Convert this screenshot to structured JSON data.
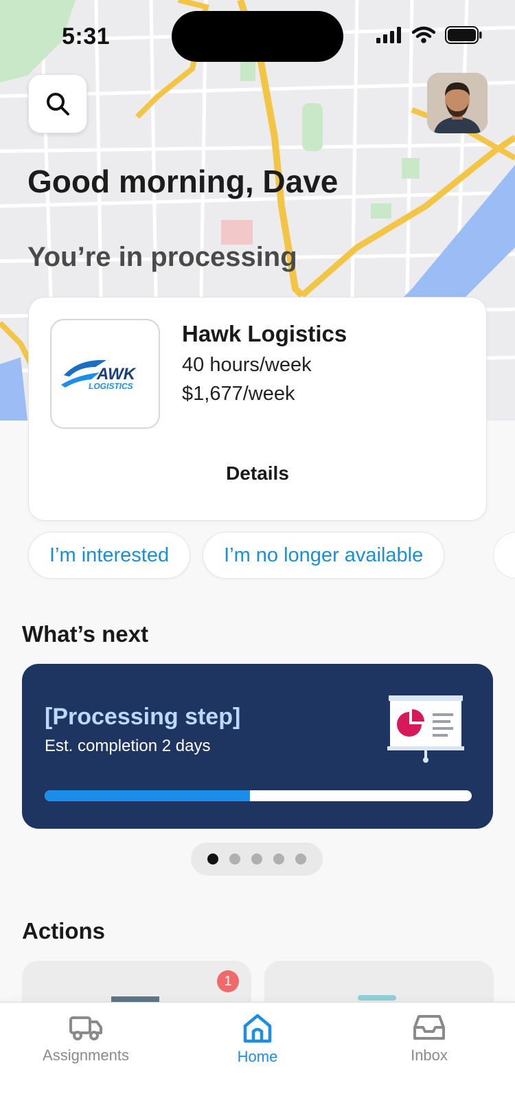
{
  "status_bar": {
    "time": "5:31"
  },
  "header": {
    "greeting": "Good morning, Dave",
    "subtitle": "You’re in processing"
  },
  "job_card": {
    "logo_text": "HAWK LOGISTICS",
    "company": "Hawk Logistics",
    "hours": "40 hours/week",
    "pay": "$1,677/week",
    "details_label": "Details"
  },
  "chips": {
    "interested": "I’m interested",
    "unavailable": "I’m no longer available"
  },
  "whats_next": {
    "title": "What’s next",
    "step_title": "[Processing step]",
    "step_sub": "Est. completion 2 days",
    "progress": 0.48,
    "pager_total": 5,
    "pager_active": 1
  },
  "actions": {
    "title": "Actions",
    "badge_count": "1"
  },
  "tabbar": {
    "tabs": [
      {
        "label": "Assignments",
        "icon": "truck-icon",
        "active": false
      },
      {
        "label": "Home",
        "icon": "home-icon",
        "active": true
      },
      {
        "label": "Inbox",
        "icon": "inbox-icon",
        "active": false
      }
    ]
  },
  "colors": {
    "accent": "#1a8ee8",
    "process_card": "#1e3461",
    "badge": "#f06a6a"
  }
}
